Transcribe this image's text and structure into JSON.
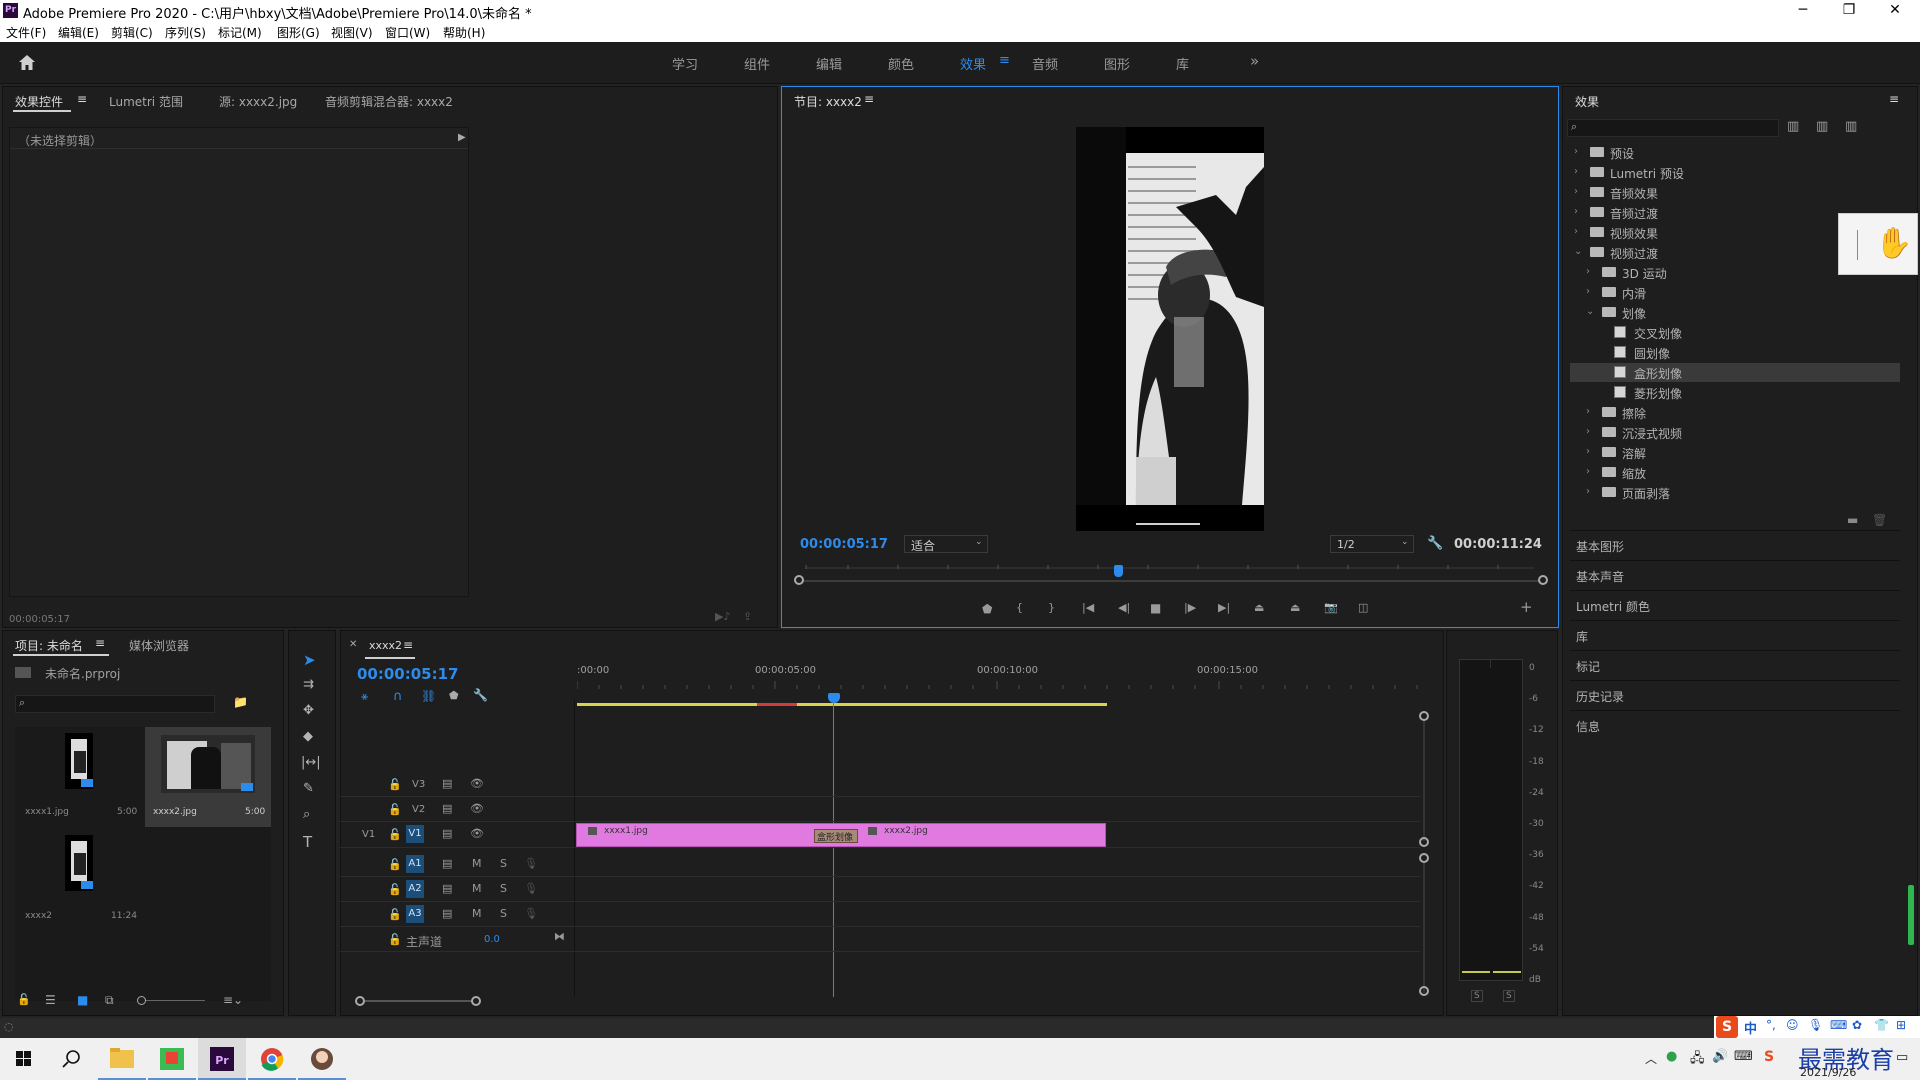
{
  "window": {
    "title": "Adobe Premiere Pro 2020 - C:\\用户\\hbxy\\文档\\Adobe\\Premiere Pro\\14.0\\未命名 *",
    "logo": "Pr"
  },
  "menu": [
    "文件(F)",
    "编辑(E)",
    "剪辑(C)",
    "序列(S)",
    "标记(M)",
    "图形(G)",
    "视图(V)",
    "窗口(W)",
    "帮助(H)"
  ],
  "workspaces": [
    "学习",
    "组件",
    "编辑",
    "颜色",
    "效果",
    "音频",
    "图形",
    "库"
  ],
  "active_workspace": "效果",
  "effect_controls": {
    "tabs": [
      "效果控件",
      "Lumetri 范围",
      "源: xxxx2.jpg",
      "音频剪辑混合器: xxxx2"
    ],
    "no_clip": "（未选择剪辑）",
    "timecode": "00:00:05:17"
  },
  "program_monitor": {
    "tab": "节目: xxxx2",
    "timecode": "00:00:05:17",
    "fit": "适合",
    "resolution": "1/2",
    "duration": "00:00:11:24"
  },
  "effects_panel": {
    "title": "效果",
    "tree": [
      {
        "label": "预设",
        "level": 0,
        "type": "folder",
        "expanded": false
      },
      {
        "label": "Lumetri 预设",
        "level": 0,
        "type": "folder",
        "expanded": false
      },
      {
        "label": "音频效果",
        "level": 0,
        "type": "folder",
        "expanded": false
      },
      {
        "label": "音频过渡",
        "level": 0,
        "type": "folder",
        "expanded": false
      },
      {
        "label": "视频效果",
        "level": 0,
        "type": "folder",
        "expanded": false
      },
      {
        "label": "视频过渡",
        "level": 0,
        "type": "folder",
        "expanded": true
      },
      {
        "label": "3D 运动",
        "level": 1,
        "type": "folder",
        "expanded": false
      },
      {
        "label": "内滑",
        "level": 1,
        "type": "folder",
        "expanded": false
      },
      {
        "label": "划像",
        "level": 1,
        "type": "folder",
        "expanded": true
      },
      {
        "label": "交叉划像",
        "level": 2,
        "type": "effect",
        "expanded": false
      },
      {
        "label": "圆划像",
        "level": 2,
        "type": "effect",
        "expanded": false
      },
      {
        "label": "盒形划像",
        "level": 2,
        "type": "effect",
        "expanded": false,
        "selected": true
      },
      {
        "label": "菱形划像",
        "level": 2,
        "type": "effect",
        "expanded": false
      },
      {
        "label": "擦除",
        "level": 1,
        "type": "folder",
        "expanded": false
      },
      {
        "label": "沉浸式视频",
        "level": 1,
        "type": "folder",
        "expanded": false
      },
      {
        "label": "溶解",
        "level": 1,
        "type": "folder",
        "expanded": false
      },
      {
        "label": "缩放",
        "level": 1,
        "type": "folder",
        "expanded": false
      },
      {
        "label": "页面剥落",
        "level": 1,
        "type": "folder",
        "expanded": false
      }
    ],
    "sections": [
      "基本图形",
      "基本声音",
      "Lumetri 颜色",
      "库",
      "标记",
      "历史记录",
      "信息"
    ]
  },
  "project": {
    "tabs": [
      "项目: 未命名",
      "媒体浏览器"
    ],
    "file": "未命名.prproj",
    "items": [
      {
        "name": "xxxx1.jpg",
        "duration": "5:00"
      },
      {
        "name": "xxxx2.jpg",
        "duration": "5:00"
      },
      {
        "name": "xxxx2",
        "duration": "11:24"
      }
    ]
  },
  "timeline": {
    "tab": "xxxx2",
    "timecode": "00:00:05:17",
    "ruler": [
      ":00:00",
      "00:00:05:00",
      "00:00:10:00",
      "00:00:15:00"
    ],
    "video_tracks": [
      "V3",
      "V2",
      "V1"
    ],
    "audio_tracks": [
      "A1",
      "A2",
      "A3"
    ],
    "source_v1": "V1",
    "master": "主声道",
    "master_value": "0.0",
    "clips": [
      {
        "name": "xxxx1.jpg"
      },
      {
        "name": "xxxx2.jpg"
      }
    ],
    "transition": "盒形划像",
    "mute": "M",
    "solo": "S"
  },
  "audio_meter": {
    "scale": [
      "0",
      "-6",
      "-12",
      "-18",
      "-24",
      "-30",
      "-36",
      "-42",
      "-48",
      "-54",
      "dB"
    ],
    "solo_labels": [
      "S",
      "S"
    ]
  },
  "taskbar": {
    "ime": "中",
    "date": "2021/9/26",
    "watermark": "最需教育"
  },
  "colors": {
    "accent": "#2d8ceb",
    "clip": "#e079e0",
    "panel": "#1e1e1e",
    "track_target": "#1b4f7a"
  }
}
